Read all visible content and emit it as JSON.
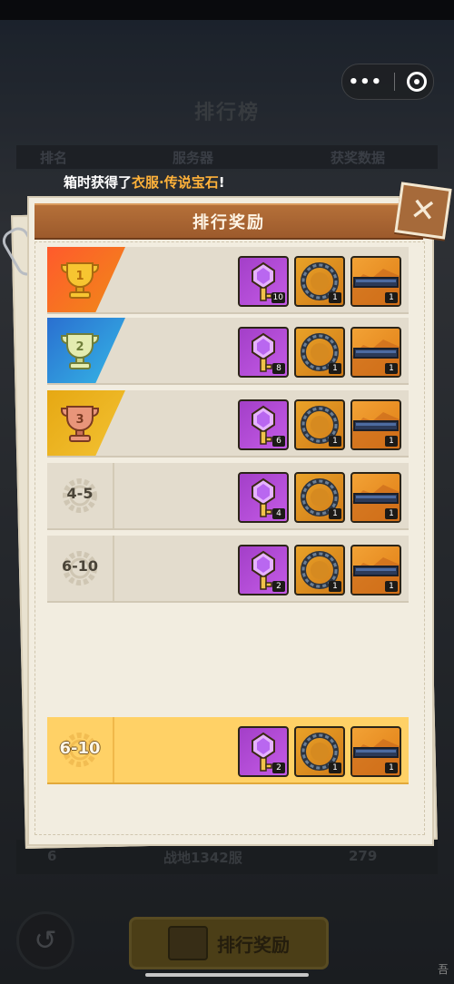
{
  "background": {
    "title": "排行榜",
    "table_headers": [
      "排名",
      "服务器",
      "获奖数据"
    ],
    "footer_row": {
      "rank": "6",
      "server": "战地1342服",
      "value": "279"
    },
    "bottom_button_label": "排行奖励",
    "back_icon": "back-arrow-icon"
  },
  "ticker": {
    "prefix": "箱时获得了",
    "item1": "衣服",
    "sep": "·",
    "item2": "传说宝石",
    "suffix": "!"
  },
  "modal": {
    "title": "排行奖励",
    "close_icon": "close-icon"
  },
  "rows": [
    {
      "rank": "1",
      "tier": "gold",
      "quantities": [
        "10",
        "1",
        "1"
      ]
    },
    {
      "rank": "2",
      "tier": "silver",
      "quantities": [
        "8",
        "1",
        "1"
      ]
    },
    {
      "rank": "3",
      "tier": "bronze",
      "quantities": [
        "6",
        "1",
        "1"
      ]
    },
    {
      "rank": "4-5",
      "tier": "plain",
      "quantities": [
        "4",
        "1",
        "1"
      ]
    },
    {
      "rank": "6-10",
      "tier": "plain",
      "quantities": [
        "2",
        "1",
        "1"
      ]
    }
  ],
  "my_row": {
    "rank": "6-10",
    "quantities": [
      "2",
      "1",
      "1"
    ]
  },
  "watermark": "吾",
  "colors": {
    "gold_tab": "#f06a22",
    "silver_tab": "#2a8fd8",
    "bronze_tab": "#ecb520",
    "highlight_row": "#ffd166",
    "modal_header": "#a8632f"
  }
}
